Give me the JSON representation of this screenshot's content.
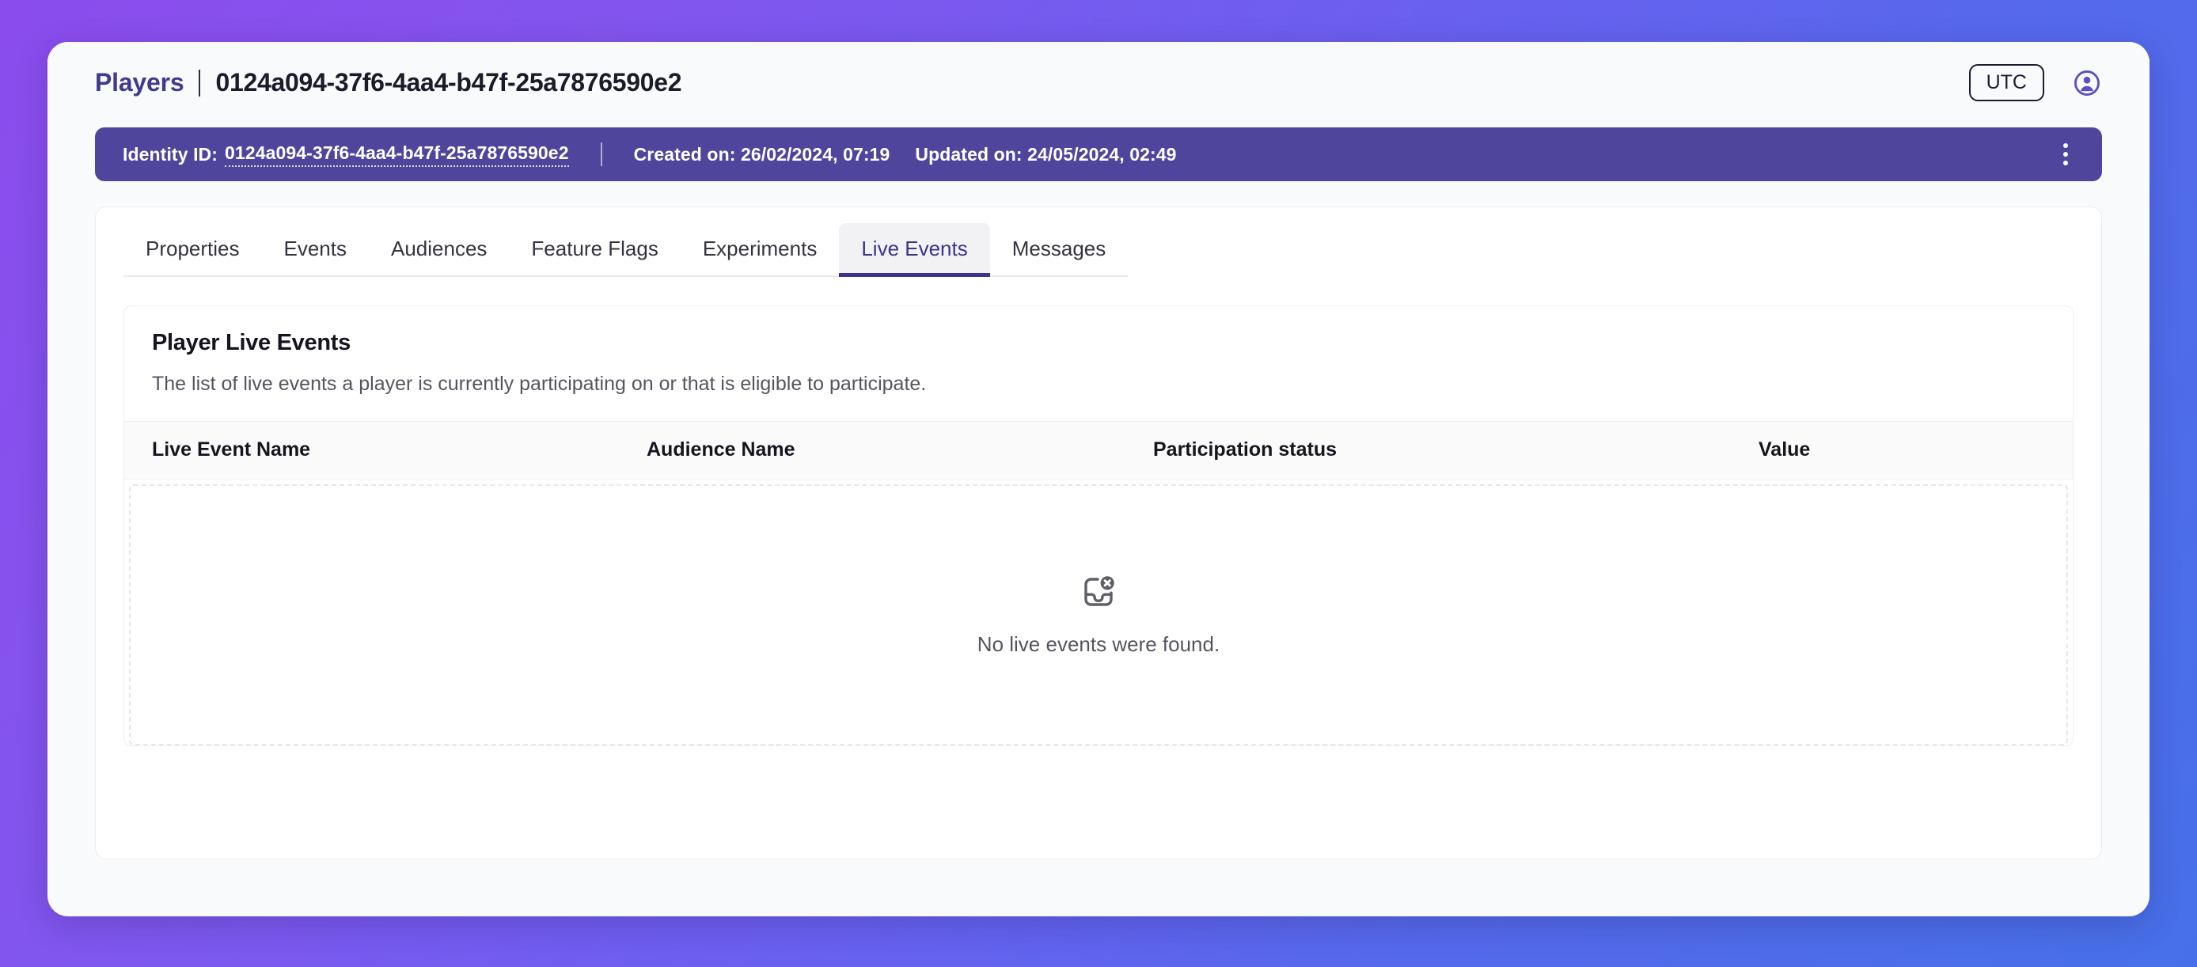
{
  "header": {
    "breadcrumb_root": "Players",
    "breadcrumb_current": "0124a094-37f6-4aa4-b47f-25a7876590e2",
    "timezone_button": "UTC",
    "avatar_icon": "user-circle-icon"
  },
  "banner": {
    "identity_label": "Identity ID:",
    "identity_value": "0124a094-37f6-4aa4-b47f-25a7876590e2",
    "created_label": "Created on: 26/02/2024, 07:19",
    "updated_label": "Updated on: 24/05/2024, 02:49",
    "menu_icon": "kebab-menu-icon",
    "background_color": "#50459c"
  },
  "tabs": [
    {
      "label": "Properties",
      "active": false
    },
    {
      "label": "Events",
      "active": false
    },
    {
      "label": "Audiences",
      "active": false
    },
    {
      "label": "Feature Flags",
      "active": false
    },
    {
      "label": "Experiments",
      "active": false
    },
    {
      "label": "Live Events",
      "active": true
    },
    {
      "label": "Messages",
      "active": false
    }
  ],
  "card": {
    "title": "Player Live Events",
    "subtitle": "The list of live events a player is currently participating on or that is eligible to participate."
  },
  "table": {
    "columns": [
      "Live Event Name",
      "Audience Name",
      "Participation status",
      "Value"
    ],
    "rows": [],
    "empty_icon": "inbox-x-icon",
    "empty_message": "No live events were found."
  },
  "theme": {
    "accent": "#3b338c",
    "link": "#413a8e",
    "gradient_start": "#8b4ced",
    "gradient_end": "#4770e8"
  }
}
